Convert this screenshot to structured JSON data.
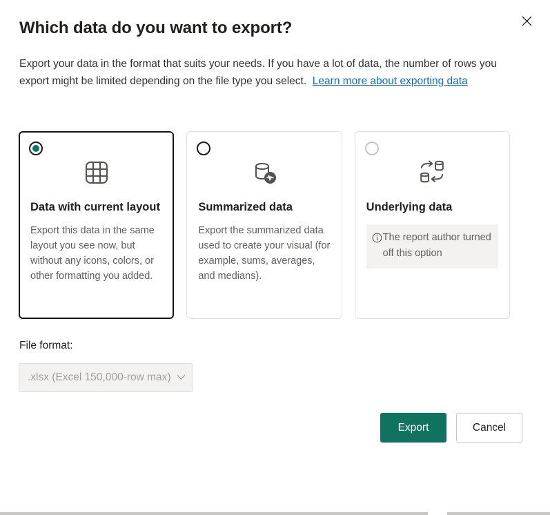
{
  "dialog": {
    "title": "Which data do you want to export?",
    "description_part1": "Export your data in the format that suits your needs. If you have a lot of data, the number of rows you export might be limited depending on the file type you select.",
    "link_label": "Learn more about exporting data",
    "close_label": "Close"
  },
  "options": [
    {
      "id": "data-with-current-layout",
      "title": "Data with current layout",
      "description": "Export this data in the same layout you see now, but without any icons, colors, or other formatting you added.",
      "icon": "table-grid-icon",
      "selected": true,
      "disabled": false
    },
    {
      "id": "summarized-data",
      "title": "Summarized data",
      "description": "Export the summarized data used to create your visual (for example, sums, averages, and medians).",
      "icon": "database-pulse-icon",
      "selected": false,
      "disabled": false
    },
    {
      "id": "underlying-data",
      "title": "Underlying data",
      "description": "",
      "notice": "The report author turned off this option",
      "icon": "database-transfer-icon",
      "selected": false,
      "disabled": true
    }
  ],
  "file_format": {
    "label": "File format:",
    "selected_value": ".xlsx (Excel 150,000-row max)",
    "chevron": "chevron-down-icon"
  },
  "footer": {
    "export_label": "Export",
    "cancel_label": "Cancel"
  },
  "colors": {
    "accent_green": "#107360",
    "link_blue": "#0f6cbd",
    "selected_border": "#161514",
    "notice_background": "#f3f2f1",
    "text_primary": "#201f1e",
    "text_secondary": "#605e5c"
  }
}
